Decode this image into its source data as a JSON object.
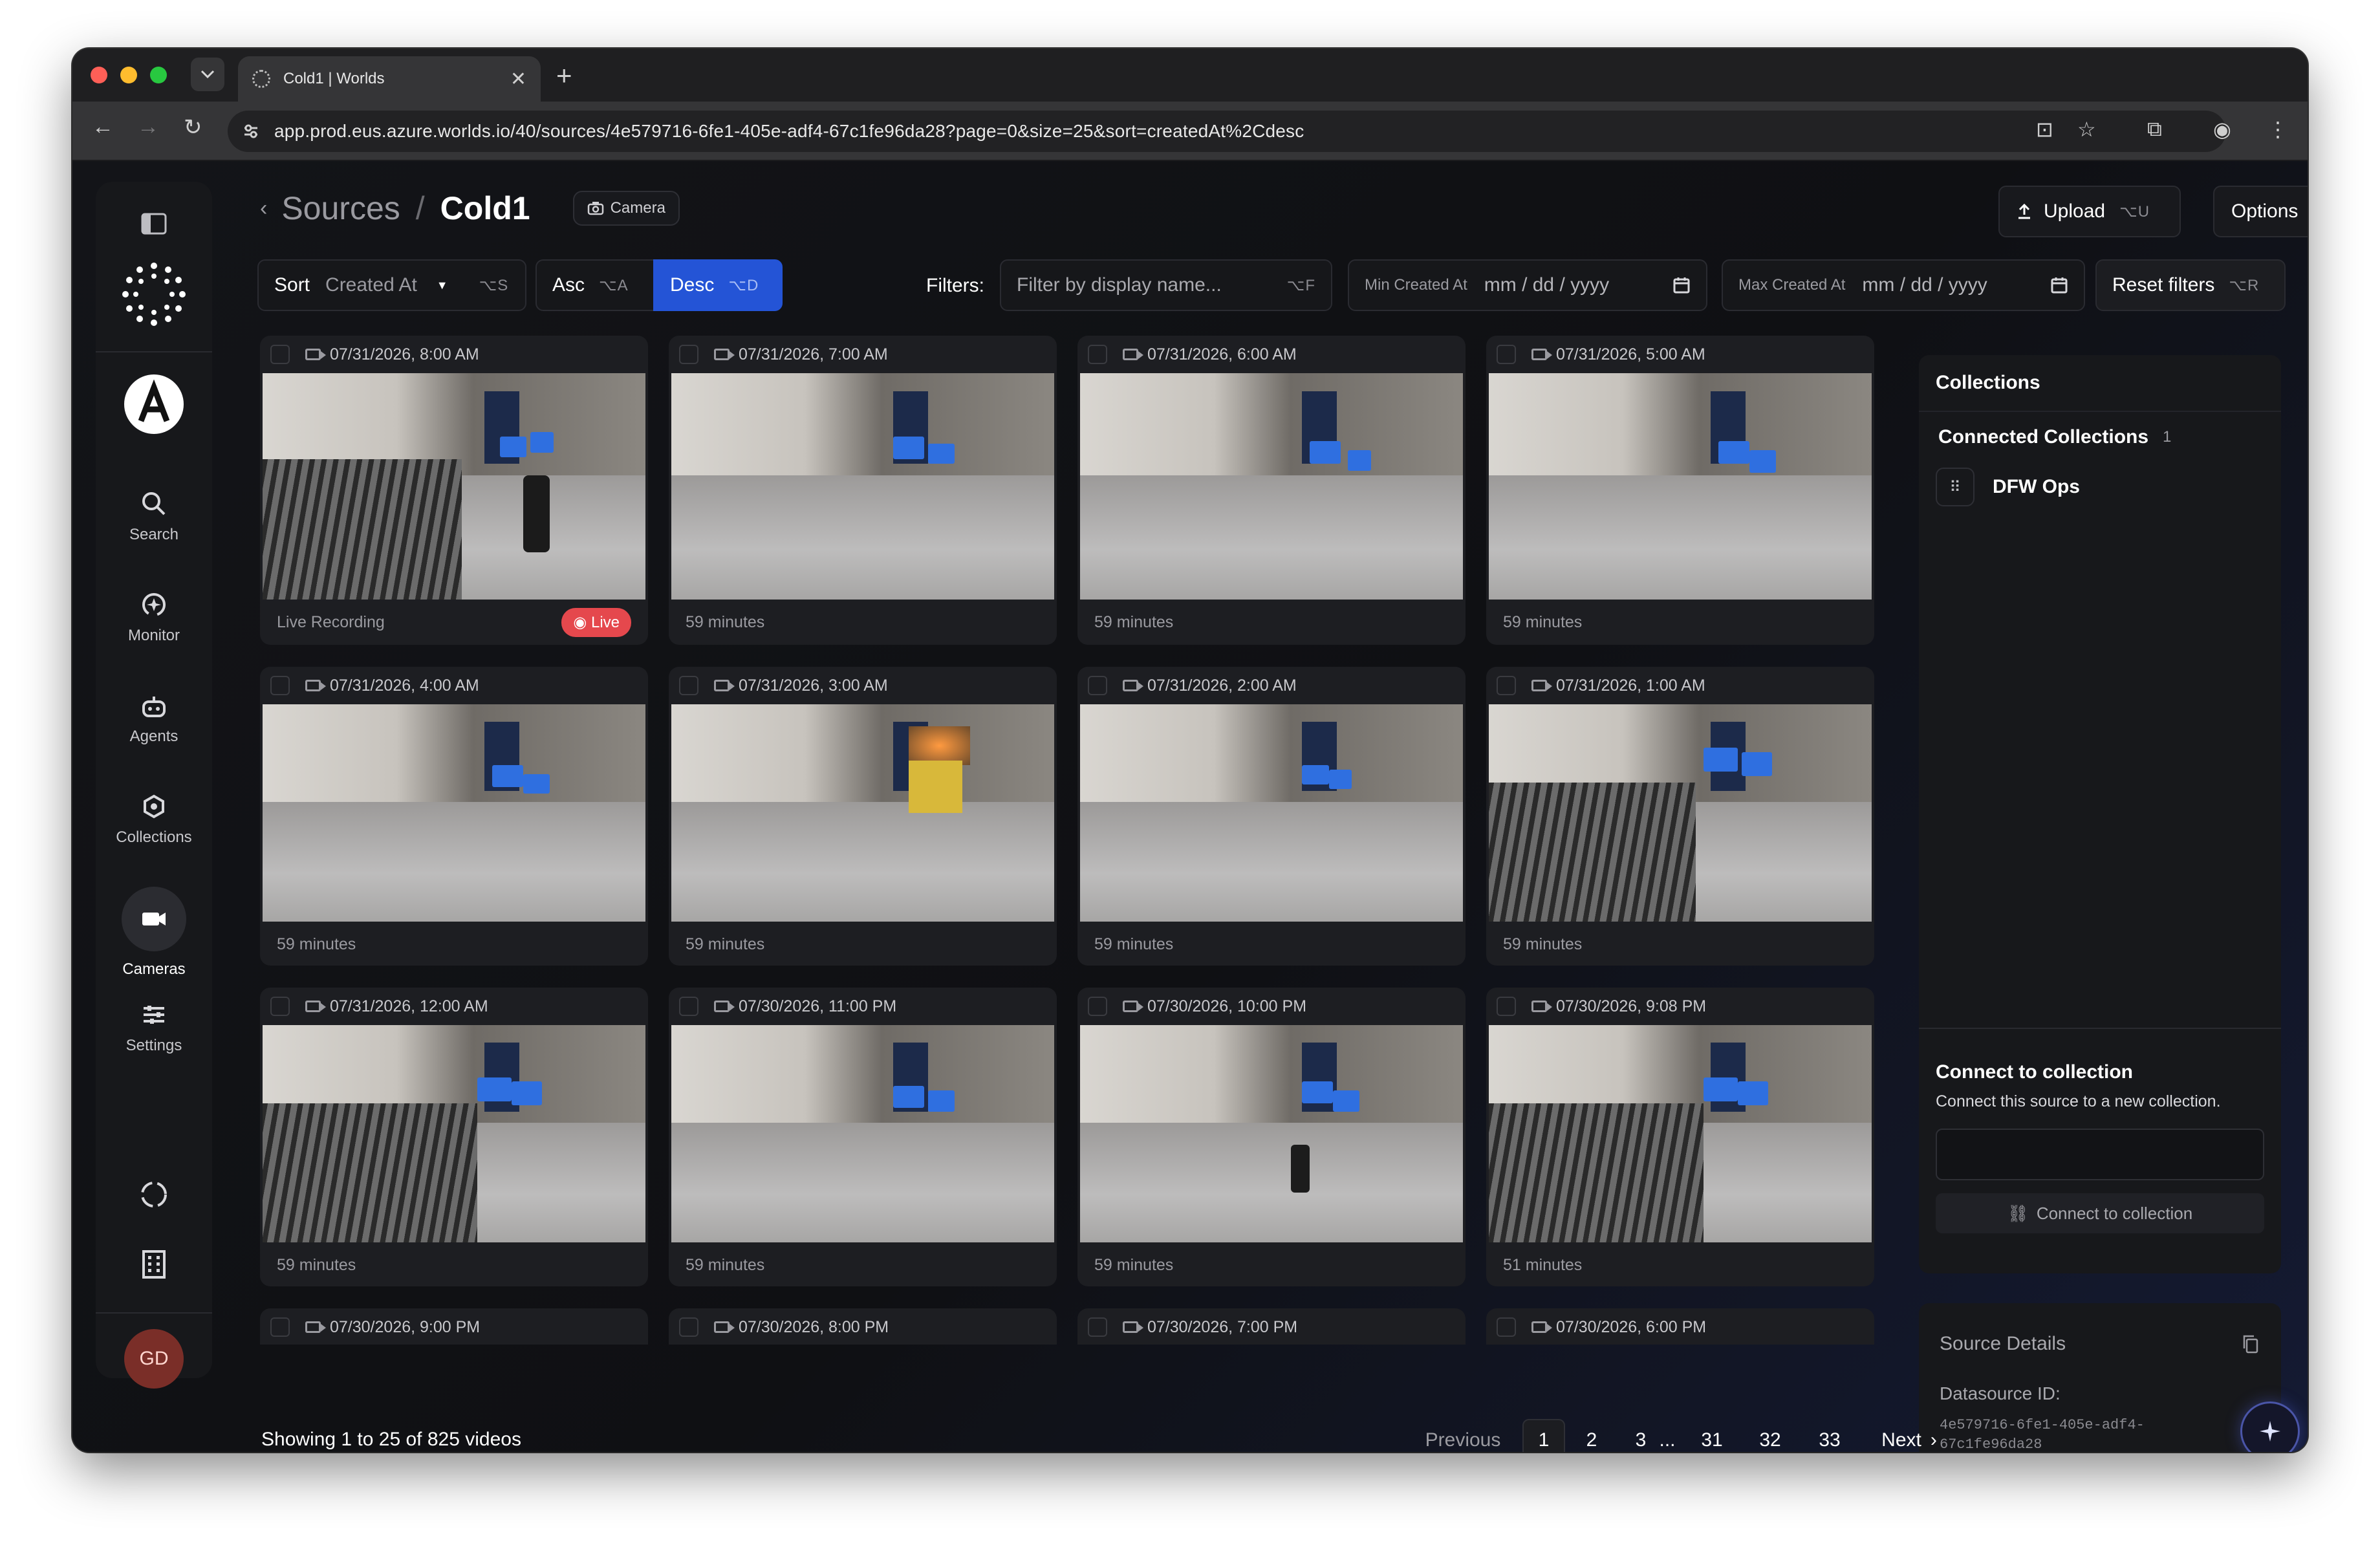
{
  "browser": {
    "tab_title": "Cold1 | Worlds",
    "url": "app.prod.eus.azure.worlds.io/40/sources/4e579716-6fe1-405e-adf4-67c1fe96da28?page=0&size=25&sort=createdAt%2Cdesc"
  },
  "sidebar": {
    "items": [
      {
        "label": "Search",
        "icon": "search-icon"
      },
      {
        "label": "Monitor",
        "icon": "monitor-icon"
      },
      {
        "label": "Agents",
        "icon": "agents-icon"
      },
      {
        "label": "Collections",
        "icon": "collections-icon"
      },
      {
        "label": "Cameras",
        "icon": "cameras-icon"
      },
      {
        "label": "Settings",
        "icon": "settings-icon"
      }
    ],
    "avatar": "GD"
  },
  "header": {
    "breadcrumb_parent": "Sources",
    "breadcrumb_sep": "/",
    "title": "Cold1",
    "chip": "Camera",
    "upload_label": "Upload",
    "upload_kbd": "⌥U",
    "options_label": "Options"
  },
  "filters": {
    "sort_label": "Sort",
    "sort_value": "Created At",
    "sort_kbd": "⌥S",
    "asc_label": "Asc",
    "asc_kbd": "⌥A",
    "desc_label": "Desc",
    "desc_kbd": "⌥D",
    "filters_label": "Filters:",
    "name_placeholder": "Filter by display name...",
    "name_kbd": "⌥F",
    "min_label": "Min Created At",
    "min_placeholder": "mm / dd / yyyy",
    "max_label": "Max Created At",
    "max_placeholder": "mm / dd / yyyy",
    "reset_label": "Reset filters",
    "reset_kbd": "⌥R"
  },
  "videos": [
    {
      "date": "07/31/2026, 8:00 AM",
      "duration": "Live Recording",
      "live": "Live"
    },
    {
      "date": "07/31/2026, 7:00 AM",
      "duration": "59 minutes"
    },
    {
      "date": "07/31/2026, 6:00 AM",
      "duration": "59 minutes"
    },
    {
      "date": "07/31/2026, 5:00 AM",
      "duration": "59 minutes"
    },
    {
      "date": "07/31/2026, 4:00 AM",
      "duration": "59 minutes"
    },
    {
      "date": "07/31/2026, 3:00 AM",
      "duration": "59 minutes"
    },
    {
      "date": "07/31/2026, 2:00 AM",
      "duration": "59 minutes"
    },
    {
      "date": "07/31/2026, 1:00 AM",
      "duration": "59 minutes"
    },
    {
      "date": "07/31/2026, 12:00 AM",
      "duration": "59 minutes"
    },
    {
      "date": "07/30/2026, 11:00 PM",
      "duration": "59 minutes"
    },
    {
      "date": "07/30/2026, 10:00 PM",
      "duration": "59 minutes"
    },
    {
      "date": "07/30/2026, 9:08 PM",
      "duration": "51 minutes"
    },
    {
      "date": "07/30/2026, 9:00 PM",
      "duration": ""
    },
    {
      "date": "07/30/2026, 8:00 PM",
      "duration": ""
    },
    {
      "date": "07/30/2026, 7:00 PM",
      "duration": ""
    },
    {
      "date": "07/30/2026, 6:00 PM",
      "duration": ""
    }
  ],
  "collections": {
    "title": "Collections",
    "connected_label": "Connected Collections",
    "connected_count": "1",
    "items": [
      "DFW Ops"
    ],
    "connect_title": "Connect to collection",
    "connect_desc": "Connect this source to a new collection.",
    "connect_button": "Connect to collection"
  },
  "source_details": {
    "title": "Source Details",
    "datasource_label": "Datasource ID:",
    "datasource_id_line1": "4e579716-6fe1-405e-adf4-",
    "datasource_id_line2": "67c1fe96da28"
  },
  "pagination": {
    "showing": "Showing 1 to 25 of 825 videos",
    "previous": "Previous",
    "pages": [
      "1",
      "2",
      "3",
      "...",
      "31",
      "32",
      "33"
    ],
    "current": "1",
    "next": "Next"
  },
  "colors": {
    "accent": "#2454d6",
    "live": "#e5484d",
    "app_bg": "#111214"
  }
}
